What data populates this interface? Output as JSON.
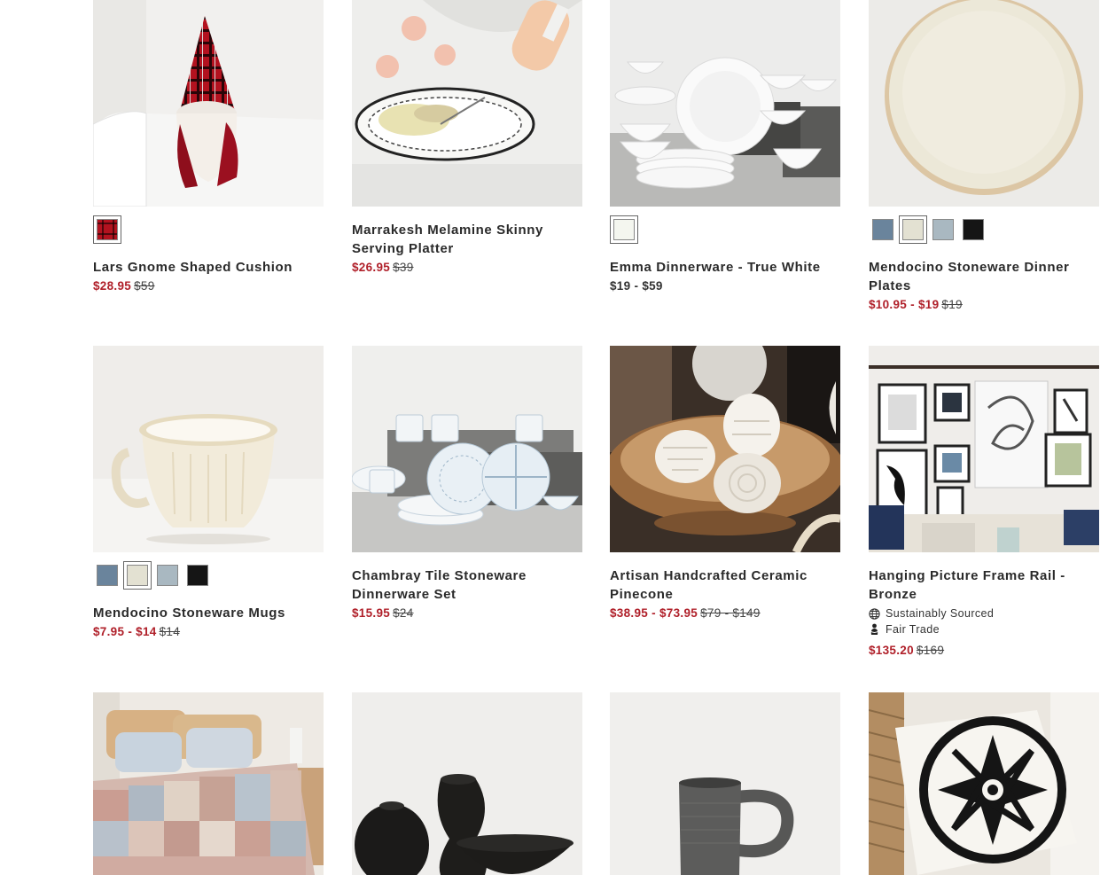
{
  "products": [
    {
      "name": "Lars Gnome Shaped Cushion",
      "sale": "$28.95",
      "orig": "$59",
      "swatches": [
        "plaid"
      ]
    },
    {
      "name": "Marrakesh Melamine Skinny Serving Platter",
      "sale": "$26.95",
      "orig": "$39",
      "swatches": []
    },
    {
      "name": "Emma Dinnerware - True White",
      "regular": "$19 - $59",
      "swatches": [
        "#f4f6ef"
      ]
    },
    {
      "name": "Mendocino Stoneware Dinner Plates",
      "sale": "$10.95 - $19",
      "orig": "$19",
      "swatches": [
        "#6a849c",
        "#e3e1d2",
        "#a9b8c1",
        "#151515"
      ]
    },
    {
      "name": "Mendocino Stoneware Mugs",
      "sale": "$7.95 - $14",
      "orig": "$14",
      "swatches": [
        "#6a849c",
        "#e3e1d2",
        "#a9b8c1",
        "#151515"
      ]
    },
    {
      "name": "Chambray Tile Stoneware Dinnerware Set",
      "sale": "$15.95",
      "orig": "$24",
      "swatches": []
    },
    {
      "name": "Artisan Handcrafted Ceramic Pinecone",
      "sale": "$38.95 - $73.95",
      "orig": "$79 - $149",
      "swatches": []
    },
    {
      "name": "Hanging Picture Frame Rail - Bronze",
      "sale": "$135.20",
      "orig": "$169",
      "badges": [
        {
          "icon": "globe-icon",
          "label": "Sustainably Sourced"
        },
        {
          "icon": "fair-trade-icon",
          "label": "Fair Trade"
        }
      ],
      "swatches": []
    }
  ],
  "images": [
    "Lars Gnome Shaped Cushion",
    "Marrakesh Melamine Skinny Serving Platter",
    "Emma Dinnerware - True White",
    "Mendocino Stoneware Dinner Plates",
    "Mendocino Stoneware Mugs",
    "Chambray Tile Stoneware Dinnerware Set",
    "Artisan Handcrafted Ceramic Pinecone",
    "Hanging Picture Frame Rail - Bronze",
    "patchwork-quilt",
    "black-woven-vases",
    "gray-mug",
    "black-white-medallion-pillow"
  ],
  "colors": {
    "sale": "#b0202a",
    "text": "#2a2a2a"
  }
}
